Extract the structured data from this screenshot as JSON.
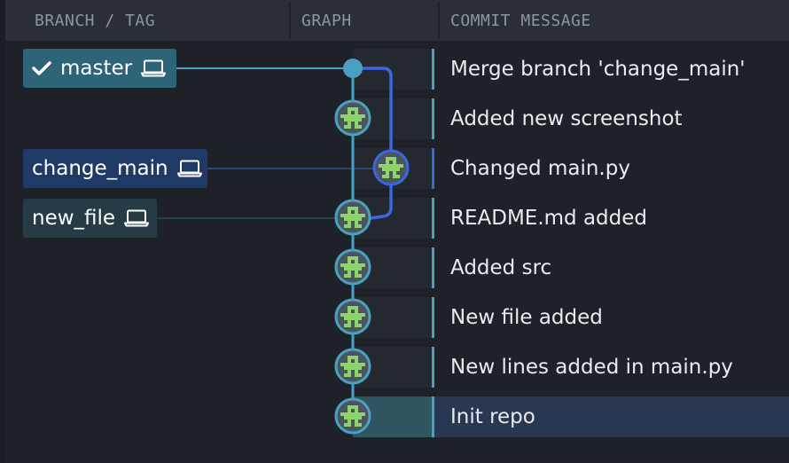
{
  "header": {
    "columns": [
      {
        "key": "branch",
        "label": "BRANCH / TAG"
      },
      {
        "key": "graph",
        "label": "GRAPH"
      },
      {
        "key": "message",
        "label": "COMMIT MESSAGE"
      }
    ]
  },
  "colors": {
    "main_branch": "#4aa0c2",
    "side_branch": "#3a66e0",
    "node_fill": "#8fd46a",
    "selected_row": "#283752",
    "branch_master_bg": "#2e6478",
    "branch_change_main_bg": "#1f3a66",
    "branch_new_file_bg": "#253c46"
  },
  "branches": [
    {
      "name": "master",
      "current": true,
      "icon": "laptop-icon",
      "checked_out_icon": "checkmark-icon"
    },
    {
      "name": "change_main",
      "current": false,
      "icon": "laptop-icon"
    },
    {
      "name": "new_file",
      "current": false,
      "icon": "laptop-icon"
    }
  ],
  "commits": [
    {
      "message": "Merge branch 'change_main'",
      "lane": "main",
      "kind": "merge",
      "avatar": false
    },
    {
      "message": "Added new screenshot",
      "lane": "main",
      "avatar": true
    },
    {
      "message": "Changed main.py",
      "lane": "side",
      "avatar": true
    },
    {
      "message": "README.md added",
      "lane": "main",
      "avatar": true
    },
    {
      "message": "Added src",
      "lane": "main",
      "avatar": true
    },
    {
      "message": "New file added",
      "lane": "main",
      "avatar": true
    },
    {
      "message": "New lines added in main.py",
      "lane": "main",
      "avatar": true
    },
    {
      "message": "Init repo",
      "lane": "main",
      "avatar": true,
      "selected": true
    }
  ]
}
